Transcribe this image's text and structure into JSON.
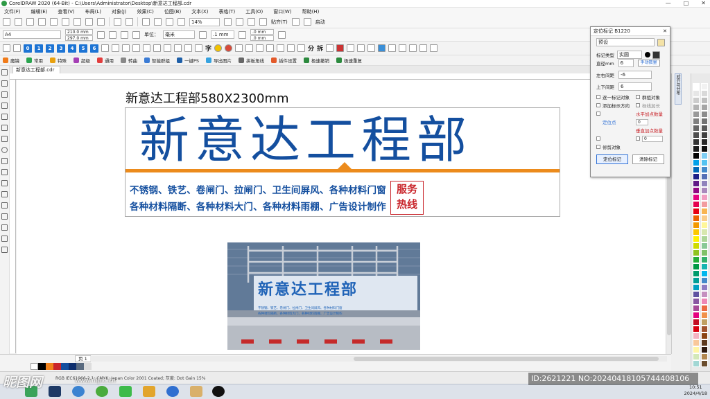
{
  "window": {
    "title": "CorelDRAW 2020 (64-Bit) - C:\\Users\\Administrator\\Desktop\\新意达工程部.cdr",
    "controls": [
      "minimize-icon",
      "maximize-icon",
      "close-icon"
    ]
  },
  "menu": [
    "文件(F)",
    "编辑(E)",
    "查看(V)",
    "布局(L)",
    "对象(J)",
    "效果(C)",
    "位图(B)",
    "文本(X)",
    "表格(T)",
    "工具(O)",
    "窗口(W)",
    "帮助(H)"
  ],
  "toolbar1": {
    "zoom_value": "14%",
    "snap_label": "贴齐(T)",
    "launch_label": "启动"
  },
  "toolbar2": {
    "page_size": "A4",
    "width": "210.0 mm",
    "height": "297.0 mm",
    "units_label": "单位：",
    "units_value": "毫米",
    "nudge": ".1 mm",
    "dup_x": ".0 mm",
    "dup_y": ".0 mm"
  },
  "toolbar3": {
    "numbers": [
      "0",
      "1",
      "2",
      "3",
      "4",
      "5",
      "6"
    ],
    "text_tools": [
      "字",
      "分",
      "拆"
    ]
  },
  "plugin_bar": {
    "items": [
      "魔镜",
      "常用",
      "特殊",
      "超级",
      "通用",
      "转曲",
      "智能群组",
      "一键PS",
      "导出图片",
      "拼板角线",
      "插件设置",
      "极速撤销",
      "极速重复"
    ]
  },
  "document_tab": "新意达工程部.cdr",
  "page_tab": "页 1",
  "design": {
    "size_label": "新意达工程部580X2300mm",
    "company_name": "新意达工程部",
    "line1": "不锈钢、铁艺、卷闸门、拉闸门、卫生间屏风、各种材料门窗",
    "line2": "各种材料隔断、各种材料大门、各种材料雨棚、广告设计制作",
    "hotline": [
      "服务",
      "热线"
    ]
  },
  "photo": {
    "sign_name": "新意达工程部",
    "sign_line1": "不锈钢、铁艺、卷闸门、拉闸门、卫生间屏风、各种材料门窗",
    "sign_line2": "各种材料隔断、各种材料大门、各种材料雨棚、广告设计制作"
  },
  "dialog": {
    "title": "定位标记 B1220",
    "preset": "预设",
    "mark_type_label": "标记类型",
    "mark_type_value": "实圆",
    "diameter_label": "直径mm",
    "diameter_value": "6",
    "manual_label": "手动数量",
    "lr_label": "左右间距",
    "lr_value": "-6",
    "tb_label": "上下间距",
    "tb_value": "6",
    "checks": [
      "逐一标记对象",
      "群组对象",
      "添加标示方向",
      "标线加长",
      "定位点",
      "水平加点数量",
      "垂直加点数量",
      "修剪对象"
    ],
    "h_count": "0",
    "v_count": "0",
    "btn_apply": "定位标记",
    "btn_clear": "清除标记"
  },
  "docker_tab": "对齐与分布",
  "status": {
    "color_profile": "RGB IEC61966-2.1; CMYK: Japan Color 2001 Coated; 灰度: Dot Gain 15%"
  },
  "watermark": {
    "brand": "昵图网",
    "url": "www.nipic.cn",
    "id": "ID:2621221 NO:20240418105744408106"
  },
  "clock": {
    "time": "10:51",
    "date": "2024/4/18"
  },
  "colors": {
    "brand_blue": "#144f9f",
    "orange": "#ec8b1c",
    "red": "#c9252b"
  }
}
